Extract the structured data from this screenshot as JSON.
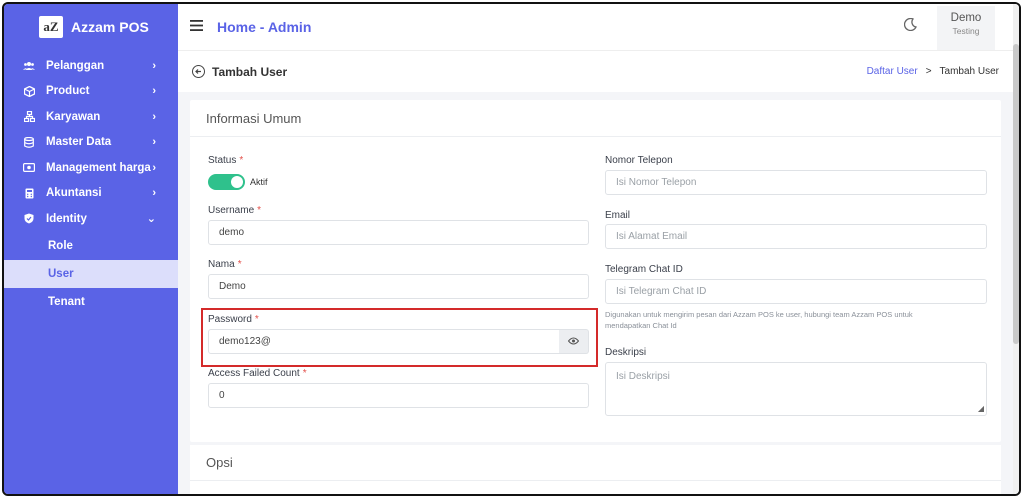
{
  "brand": {
    "logo_text": "aZ",
    "name": "Azzam POS"
  },
  "sidebar": {
    "items": [
      {
        "label": "Pelanggan",
        "icon": "users-icon",
        "chevron": "›"
      },
      {
        "label": "Product",
        "icon": "box-icon",
        "chevron": "›"
      },
      {
        "label": "Karyawan",
        "icon": "org-icon",
        "chevron": "›"
      },
      {
        "label": "Master Data",
        "icon": "database-icon",
        "chevron": "›"
      },
      {
        "label": "Management harga",
        "icon": "money-icon",
        "chevron": "›"
      },
      {
        "label": "Akuntansi",
        "icon": "calculator-icon",
        "chevron": "›"
      },
      {
        "label": "Identity",
        "icon": "shield-icon",
        "chevron": "⌄"
      }
    ],
    "sub_items": [
      {
        "label": "Role"
      },
      {
        "label": "User"
      },
      {
        "label": "Tenant"
      }
    ]
  },
  "header": {
    "title": "Home - Admin",
    "user_name": "Demo",
    "user_role": "Testing"
  },
  "subheader": {
    "title": "Tambah User",
    "breadcrumb": {
      "link": "Daftar User",
      "separator": ">",
      "current": "Tambah User"
    }
  },
  "form": {
    "section_title": "Informasi Umum",
    "status": {
      "label": "Status",
      "required": "*",
      "toggle_text": "Aktif"
    },
    "username": {
      "label": "Username",
      "required": "*",
      "value": "demo"
    },
    "nama": {
      "label": "Nama",
      "required": "*",
      "value": "Demo"
    },
    "password": {
      "label": "Password",
      "required": "*",
      "value": "demo123@"
    },
    "access_failed": {
      "label": "Access Failed Count",
      "required": "*",
      "value": "0"
    },
    "nomor_telepon": {
      "label": "Nomor Telepon",
      "placeholder": "Isi Nomor Telepon"
    },
    "email": {
      "label": "Email",
      "placeholder": "Isi Alamat Email"
    },
    "telegram": {
      "label": "Telegram Chat ID",
      "placeholder": "Isi Telegram Chat ID",
      "help_line1": "Digunakan untuk mengirim pesan dari Azzam POS ke user, hubungi team Azzam POS untuk",
      "help_line2": "mendapatkan Chat Id"
    },
    "deskripsi": {
      "label": "Deskripsi",
      "placeholder": "Isi Deskripsi"
    }
  },
  "options": {
    "section_title": "Opsi"
  },
  "colors": {
    "primary": "#5a63e6",
    "toggle_on": "#2fc18c",
    "highlight": "#d42a2a",
    "required": "#e3504a"
  }
}
